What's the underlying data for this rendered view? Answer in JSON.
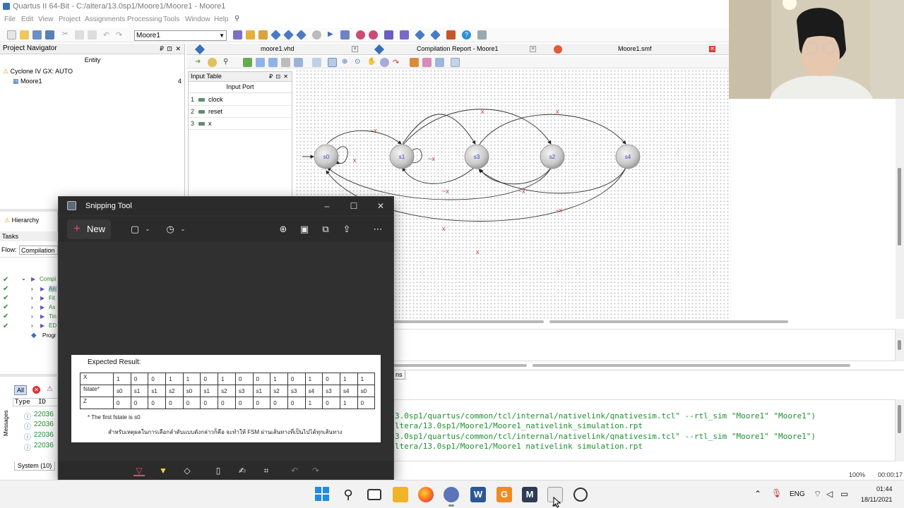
{
  "app": {
    "title": "Quartus II 64-Bit - C:/altera/13.0sp1/Moore1/Moore1 - Moore1",
    "menu": [
      "File",
      "Edit",
      "View",
      "Project",
      "Assignments",
      "Processing",
      "Tools",
      "Window",
      "Help"
    ],
    "entity_select": "Moore1"
  },
  "project_navigator": {
    "title": "Project Navigator",
    "column_header": "Entity",
    "device": "Cyclone IV GX: AUTO",
    "top_entity": "Moore1",
    "top_entity_count": "4",
    "tab": "Hierarchy"
  },
  "tasks": {
    "title": "Tasks",
    "flow_label": "Flow:",
    "flow_value": "Compilation",
    "items": [
      "Compi",
      "An",
      "Fit",
      "As",
      "Tin",
      "ED",
      "Progr"
    ]
  },
  "doc_tabs": [
    {
      "label": "moore1.vhd"
    },
    {
      "label": "Compilation Report - Moore1"
    },
    {
      "label": "Moore1.smf"
    }
  ],
  "input_table": {
    "title": "Input Table",
    "column": "Input Port",
    "rows": [
      {
        "num": "1",
        "name": "clock"
      },
      {
        "num": "2",
        "name": "reset"
      },
      {
        "num": "3",
        "name": "x"
      }
    ]
  },
  "fsm": {
    "states": [
      "s0",
      "s1",
      "s3",
      "s2",
      "s4"
    ],
    "labels": [
      "x",
      "~x",
      "x",
      "~x",
      "x",
      "~x",
      "x",
      "~x",
      "x",
      "x"
    ]
  },
  "messages": {
    "filter_all": "All",
    "col_type": "Type",
    "col_id": "ID",
    "ids": [
      "22036",
      "22036",
      "22036",
      "22036"
    ],
    "tab_system": "System (10)",
    "side_label": "Messages",
    "tab_fragment": "ns"
  },
  "console_lines": [
    "3.0sp1/quartus/common/tcl/internal/nativelink/qnativesim.tcl\" --rtl_sim \"Moore1\" \"Moore1\")",
    "ltera/13.0sp1/Moore1/Moore1_nativelink_simulation.rpt",
    "3.0sp1/quartus/common/tcl/internal/nativelink/qnativesim.tcl\" --rtl_sim \"Moore1\" \"Moore1\")",
    "ltera/13.0sp1/Moore1/Moore1 nativelink simulation.rpt"
  ],
  "status": {
    "zoom": "100%",
    "time": "00:00:17"
  },
  "snipping_tool": {
    "title": "Snipping Tool",
    "new_label": "New",
    "capture": {
      "heading": "Expected Result:",
      "rows": [
        {
          "label": "X",
          "cells": [
            "1",
            "0",
            "0",
            "1",
            "1",
            "0",
            "1",
            "0",
            "0",
            "1",
            "0",
            "1",
            "0",
            "1",
            "1"
          ]
        },
        {
          "label": "fstate*",
          "cells": [
            "s0",
            "s1",
            "s1",
            "s2",
            "s0",
            "s1",
            "s2",
            "s3",
            "s1",
            "s2",
            "s3",
            "s4",
            "s3",
            "s4",
            "s0"
          ]
        },
        {
          "label": "Z",
          "cells": [
            "0",
            "0",
            "0",
            "0",
            "0",
            "0",
            "0",
            "0",
            "0",
            "0",
            "0",
            "1",
            "0",
            "1",
            "0"
          ]
        }
      ],
      "note": "* The first fstate is s0",
      "thai_note": "สำหรับเหตุผลในการเลือกลำดับแบบดังกล่าวก็คือ จะทำให้ FSM ผ่านเส้นทางที่เป็นไปได้ทุกเส้นทาง"
    }
  },
  "taskbar": {
    "lang": "ENG",
    "time": "01:44",
    "date": "18/11/2021"
  }
}
